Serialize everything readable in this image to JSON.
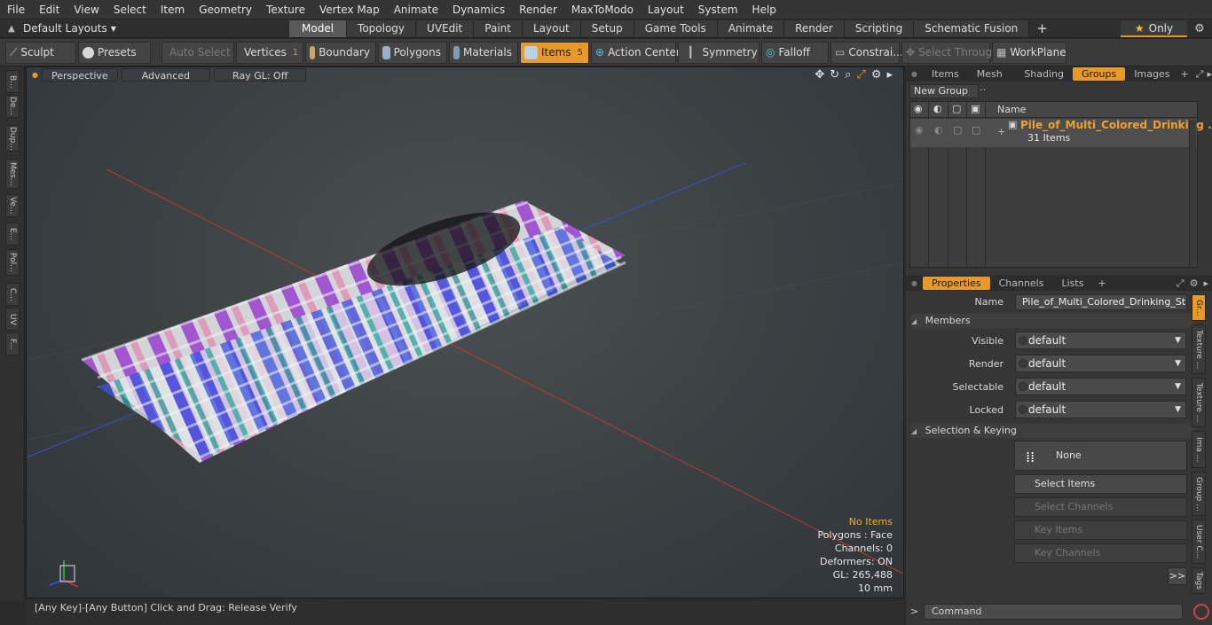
{
  "menu": [
    "File",
    "Edit",
    "View",
    "Select",
    "Item",
    "Geometry",
    "Texture",
    "Vertex Map",
    "Animate",
    "Dynamics",
    "Render",
    "MaxToModo",
    "Layout",
    "System",
    "Help"
  ],
  "layout": {
    "dropdown": "Default Layouts",
    "tabs": [
      "Model",
      "Topology",
      "UVEdit",
      "Paint",
      "Layout",
      "Setup",
      "Game Tools",
      "Animate",
      "Render",
      "Scripting",
      "Schematic Fusion"
    ],
    "active_tab": "Model",
    "only_label": "Only"
  },
  "toolbar": {
    "sculpt": "Sculpt",
    "presets": "Presets",
    "auto_select": "Auto Select",
    "vertices": "Vertices",
    "vertices_count": "1",
    "boundary": "Boundary",
    "polygons": "Polygons",
    "materials": "Materials",
    "items": "Items",
    "items_count": "5",
    "action_center": "Action Center",
    "symmetry": "Symmetry",
    "falloff": "Falloff",
    "constraints": "Constrai...",
    "select_through": "Select Through",
    "workplane": "WorkPlane"
  },
  "left_tabs": [
    "B...",
    "De...",
    "Dup...",
    "Mes...",
    "Ve...",
    "E...",
    "Pol...",
    "C...",
    "UV",
    "F..."
  ],
  "viewport": {
    "perspective": "Perspective",
    "advanced": "Advanced",
    "raygl": "Ray GL: Off",
    "hud": {
      "no_items": "No Items",
      "polygons": "Polygons : Face",
      "channels": "Channels: 0",
      "deformers": "Deformers: ON",
      "gl": "GL: 265,488",
      "scale": "10 mm"
    }
  },
  "status": "[Any Key]-[Any Button] Click and Drag:   Release Verify",
  "groups_panel": {
    "tabs": [
      "Items",
      "Mesh ...",
      "Shading",
      "Groups",
      "Images"
    ],
    "active_tab": "Groups",
    "new_group": "New Group",
    "col_name": "Name",
    "group_name": "Pile_of_Multi_Colored_Drinking ...",
    "group_count": "31 Items"
  },
  "properties": {
    "tabs": [
      "Properties",
      "Channels",
      "Lists"
    ],
    "active_tab": "Properties",
    "name_label": "Name",
    "name_value": "Pile_of_Multi_Colored_Drinking_Straw",
    "members_section": "Members",
    "fields": [
      {
        "label": "Visible",
        "value": "default"
      },
      {
        "label": "Render",
        "value": "default"
      },
      {
        "label": "Selectable",
        "value": "default"
      },
      {
        "label": "Locked",
        "value": "default"
      }
    ],
    "keying_section": "Selection & Keying",
    "none_label": "None",
    "select_items": "Select Items",
    "select_channels": "Select Channels",
    "key_items": "Key Items",
    "key_channels": "Key Channels",
    "more": ">>"
  },
  "right_vtabs": [
    "Gr...",
    "Texture ...",
    "Texture ...",
    "Ima ...",
    "Group ...",
    "User C...",
    "Tags"
  ],
  "command_placeholder": "Command",
  "colors": {
    "accent": "#e79a2a",
    "hot_text": "#f0b020"
  }
}
